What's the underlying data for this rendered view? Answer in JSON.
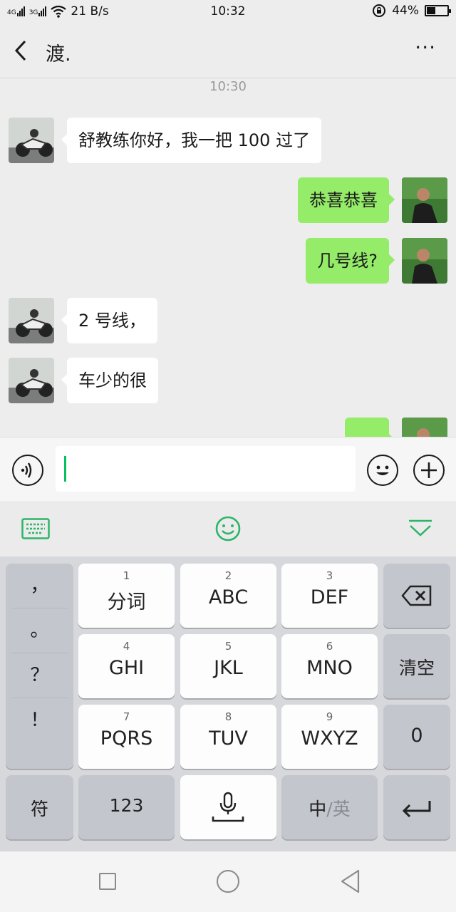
{
  "status_bar": {
    "net_left": "4G",
    "net_right": "3G",
    "speed": "21 B/s",
    "time": "10:32",
    "battery": "44%",
    "battery_level": 0.44
  },
  "header": {
    "title": "渡.",
    "more": "···"
  },
  "chat": {
    "timestamp": "10:30",
    "messages": [
      {
        "side": "left",
        "text": "舒教练你好，我一把 100 过了"
      },
      {
        "side": "right",
        "text": "恭喜恭喜"
      },
      {
        "side": "right",
        "text": "几号线?"
      },
      {
        "side": "left",
        "text": "2 号线，"
      },
      {
        "side": "left",
        "text": "车少的很"
      },
      {
        "side": "right",
        "text": ""
      }
    ]
  },
  "input_bar": {
    "text_value": ""
  },
  "keyboard": {
    "punctuation": [
      "，",
      "。",
      "？",
      "！"
    ],
    "rows": [
      [
        {
          "num": "1",
          "label": "分词"
        },
        {
          "num": "2",
          "label": "ABC"
        },
        {
          "num": "3",
          "label": "DEF"
        }
      ],
      [
        {
          "num": "4",
          "label": "GHI"
        },
        {
          "num": "5",
          "label": "JKL"
        },
        {
          "num": "6",
          "label": "MNO"
        }
      ],
      [
        {
          "num": "7",
          "label": "PQRS"
        },
        {
          "num": "8",
          "label": "TUV"
        },
        {
          "num": "9",
          "label": "WXYZ"
        }
      ]
    ],
    "clear_label": "清空",
    "zero_label": "0",
    "symbols_label": "符",
    "numbers_label": "123",
    "lang_primary": "中",
    "lang_secondary": "/英"
  },
  "colors": {
    "accent_green": "#07c160",
    "sent_bubble": "#95ec69"
  },
  "icons": [
    "back-icon",
    "more-icon",
    "voice-icon",
    "emoji-icon",
    "plus-icon",
    "keyboard-icon",
    "smiley-icon",
    "collapse-icon",
    "backspace-icon",
    "mic-icon",
    "enter-icon"
  ]
}
